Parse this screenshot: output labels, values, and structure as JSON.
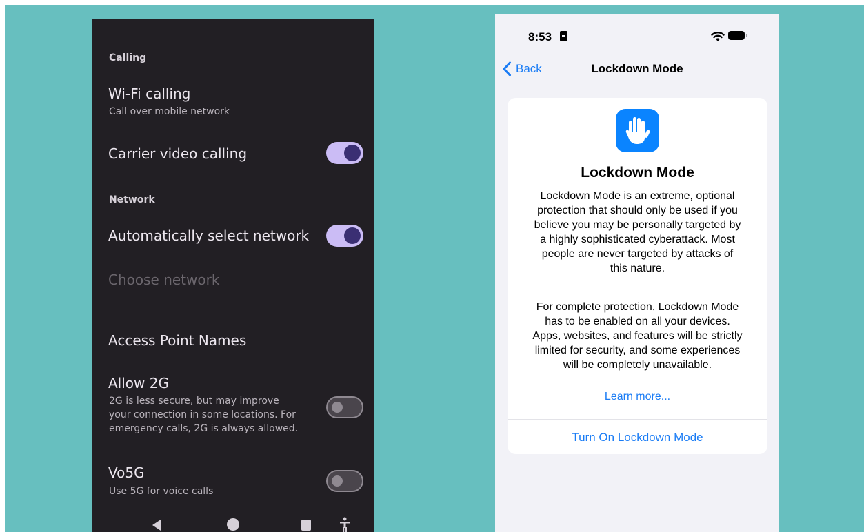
{
  "colors": {
    "teal_background": "#67bfbf",
    "android_background": "#221f24",
    "toggle_on_track": "#cbbcf5",
    "toggle_on_knob": "#3a2f73",
    "ios_accent": "#1a7cf5",
    "ios_icon_tile": "#0a84ff"
  },
  "android": {
    "section_calling": "Calling",
    "wifi_calling": {
      "title": "Wi-Fi calling",
      "subtitle": "Call over mobile network"
    },
    "carrier_video_calling": {
      "title": "Carrier video calling",
      "toggle": "on"
    },
    "section_network": "Network",
    "auto_select_network": {
      "title": "Automatically select network",
      "toggle": "on"
    },
    "choose_network": {
      "title": "Choose network",
      "enabled": false
    },
    "access_point_names": "Access Point Names",
    "allow_2g": {
      "title": "Allow 2G",
      "subtitle_lines": [
        "2G is less secure, but may improve",
        "your connection in some locations. For",
        "emergency calls, 2G is always allowed."
      ],
      "toggle": "off"
    },
    "vo5g": {
      "title": "Vo5G",
      "subtitle": "Use 5G for voice calls",
      "toggle": "off"
    },
    "nav_icons": [
      "back-triangle-icon",
      "home-circle-icon",
      "recents-square-icon",
      "accessibility-icon"
    ]
  },
  "ios": {
    "status": {
      "time": "8:53",
      "icons": [
        "sim-badge-icon",
        "wifi-icon",
        "battery-icon"
      ]
    },
    "nav": {
      "back_label": "Back",
      "title": "Lockdown Mode"
    },
    "card": {
      "icon": "raised-hand-icon",
      "title": "Lockdown Mode",
      "paragraph1_lines": [
        "Lockdown Mode is an extreme, optional",
        "protection that should only be used if you",
        "believe you may be personally targeted by",
        "a highly sophisticated cyberattack. Most",
        "people are never targeted by attacks of",
        "this nature."
      ],
      "paragraph2_lines": [
        "For complete protection, Lockdown Mode",
        "has to be enabled on all your devices.",
        "Apps, websites, and features will be strictly",
        "limited for security, and some experiences",
        "will be completely unavailable."
      ],
      "learn_more": "Learn more...",
      "action": "Turn On Lockdown Mode"
    }
  }
}
